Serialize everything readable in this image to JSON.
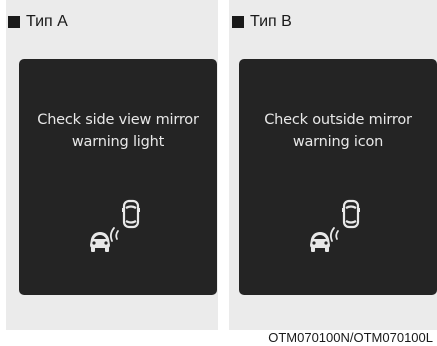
{
  "panels": [
    {
      "heading": "Тип A",
      "message_line1": "Check side view mirror",
      "message_line2": "warning light",
      "icon": "blind-spot-warning-icon"
    },
    {
      "heading": "Тип B",
      "message_line1": "Check outside mirror",
      "message_line2": "warning icon",
      "icon": "blind-spot-warning-icon"
    }
  ],
  "footer_code": "OTM070100N/OTM070100L",
  "colors": {
    "panel_background": "#ebebeb",
    "display_background": "#242424",
    "display_text": "#e8e8e8"
  }
}
